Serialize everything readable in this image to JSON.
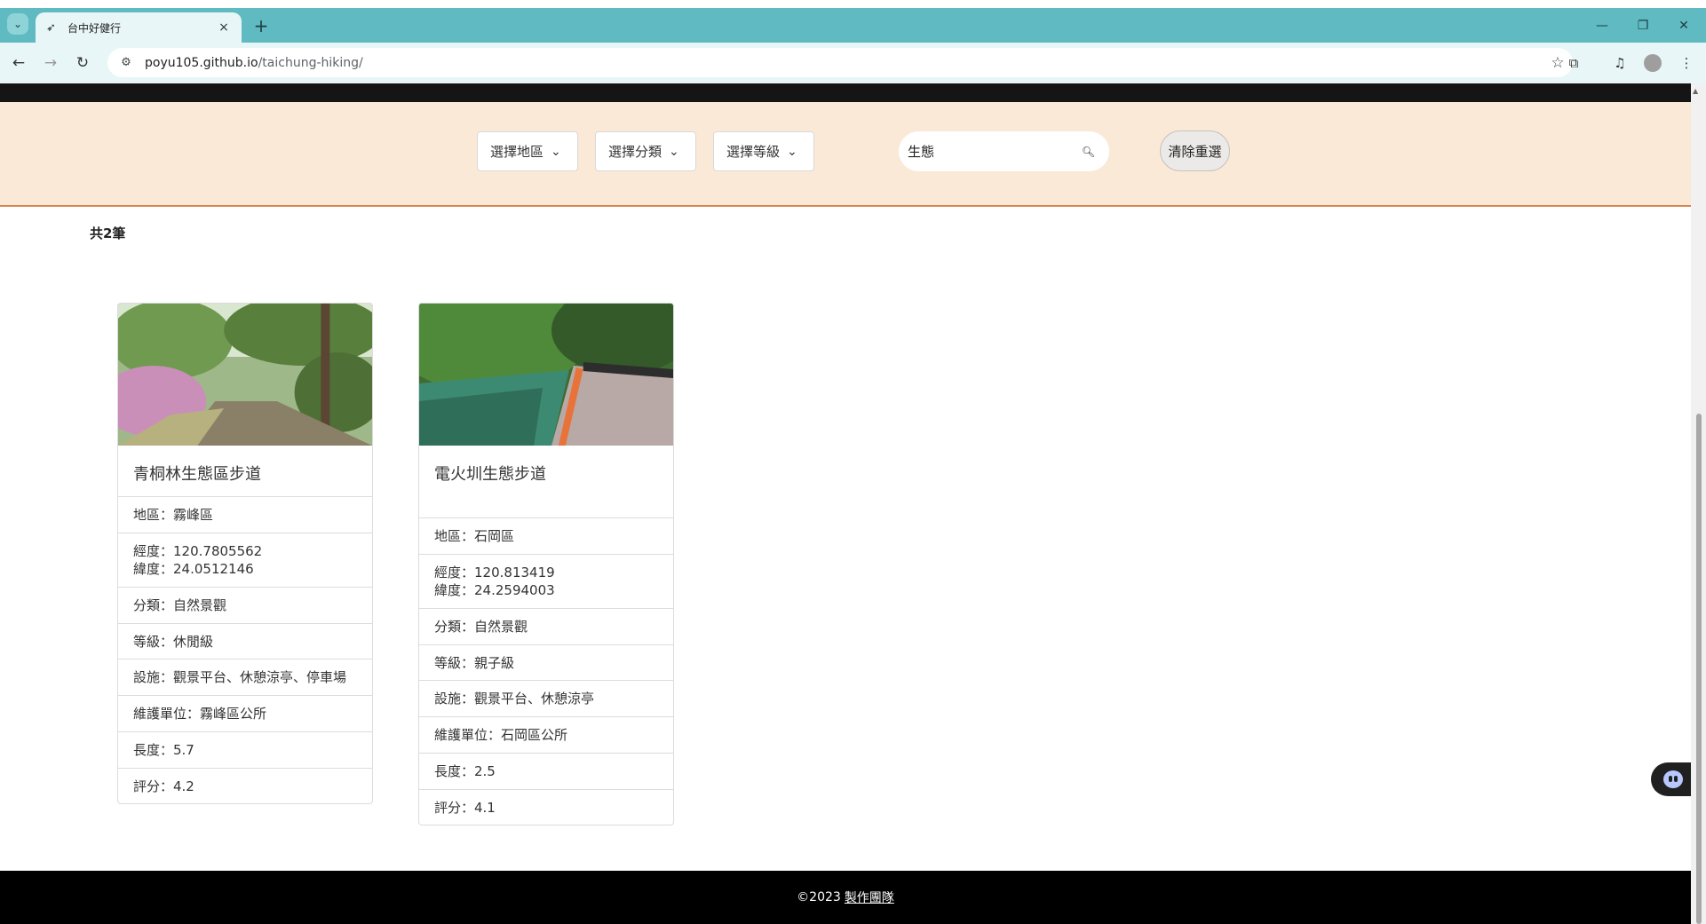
{
  "browser": {
    "tab_title": "台中好健行",
    "url_host": "poyu105.github.io",
    "url_path": "/taichung-hiking/",
    "tab_close": "×",
    "new_tab": "+"
  },
  "filters": {
    "district": "選擇地區",
    "category": "選擇分類",
    "level": "選擇等級",
    "search_value": "生態",
    "clear_button": "清除重選"
  },
  "results": {
    "count_label": "共2筆"
  },
  "cards": [
    {
      "title": "青桐林生態區步道",
      "district": "地區：霧峰區",
      "longitude": "經度：120.7805562",
      "latitude": "緯度：24.0512146",
      "category": "分類：自然景觀",
      "level": "等級：休閒級",
      "facilities": "設施：觀景平台、休憩涼亭、停車場",
      "maintainer": "維護單位：霧峰區公所",
      "length": "長度：5.7",
      "rating": "評分：4.2"
    },
    {
      "title": "電火圳生態步道",
      "district": "地區：石岡區",
      "longitude": "經度：120.813419",
      "latitude": "緯度：24.2594003",
      "category": "分類：自然景觀",
      "level": "等級：親子級",
      "facilities": "設施：觀景平台、休憩涼亭",
      "maintainer": "維護單位：石岡區公所",
      "length": "長度：2.5",
      "rating": "評分：4.1"
    }
  ],
  "footer": {
    "copyright": "©2023",
    "team_link": "製作團隊"
  },
  "colors": {
    "tabstrip": "#5fbac2",
    "filter_bg": "#fbe9d7",
    "filter_border": "#d9844f"
  }
}
